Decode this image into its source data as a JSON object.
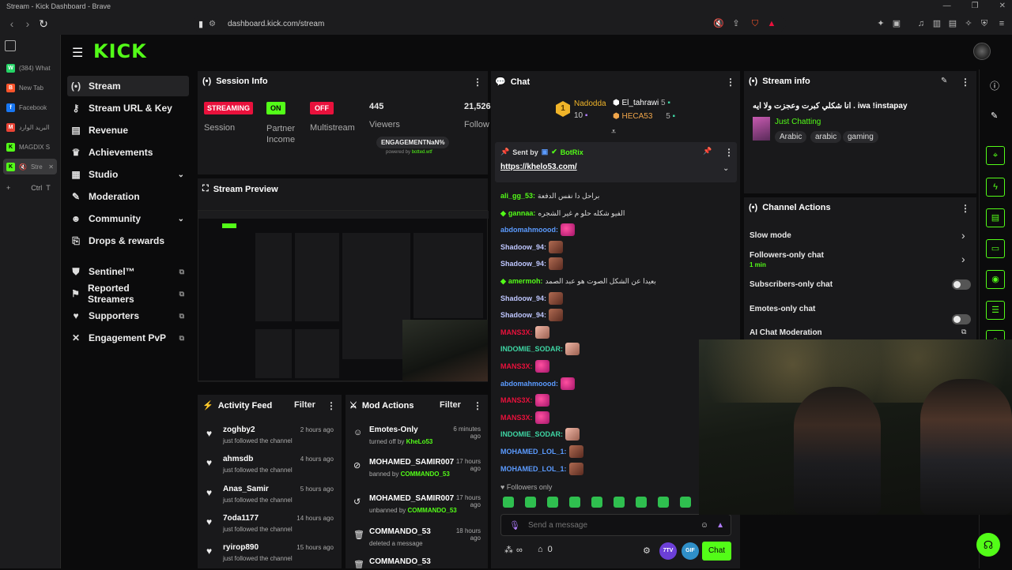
{
  "window": {
    "title": "Stream - Kick Dashboard - Brave"
  },
  "browser": {
    "url": "dashboard.kick.com/stream"
  },
  "tabs": [
    {
      "label": "(384) What",
      "color": "#25d366",
      "glyph": "W"
    },
    {
      "label": "New Tab",
      "color": "#fb542b",
      "glyph": "B"
    },
    {
      "label": "Facebook",
      "color": "#1877f2",
      "glyph": "f"
    },
    {
      "label": "البريد الوارد",
      "color": "#ea4335",
      "glyph": "M"
    },
    {
      "label": "MAGDIX S",
      "color": "#53fc18",
      "glyph": "K"
    },
    {
      "label": "Stre",
      "color": "#53fc18",
      "glyph": "K"
    }
  ],
  "new_tab_hint": {
    "ctrl": "Ctrl",
    "key": "T"
  },
  "brand": {
    "logo": "KICK",
    "accent": "#53fc18"
  },
  "nav": {
    "items": [
      {
        "label": "Stream",
        "icon": "(•)"
      },
      {
        "label": "Stream URL & Key",
        "icon": "⚷"
      },
      {
        "label": "Revenue",
        "icon": "▤"
      },
      {
        "label": "Achievements",
        "icon": "🏆"
      },
      {
        "label": "Studio",
        "icon": "▦"
      },
      {
        "label": "Moderation",
        "icon": "✎"
      },
      {
        "label": "Community",
        "icon": "👥"
      },
      {
        "label": "Drops & rewards",
        "icon": "⎘"
      },
      {
        "label": "Sentinel™",
        "icon": "⛨"
      },
      {
        "label": "Reported Streamers",
        "icon": "⚑"
      },
      {
        "label": "Supporters",
        "icon": "♥"
      },
      {
        "label": "Engagement PvP",
        "icon": "✕"
      }
    ]
  },
  "session": {
    "title": "Session Info",
    "streaming": "STREAMING",
    "on": "ON",
    "off": "OFF",
    "session_label": "Session",
    "partner_label": "Partner Income",
    "multistream_label": "Multistream",
    "viewers_value": "445",
    "viewers_label": "Viewers",
    "follow_value": "21,526",
    "follow_label": "Follow",
    "engagement": "ENGAGEMENTNaN%",
    "powered": "powered by ",
    "botted": "botted.wtf"
  },
  "preview": {
    "title": "Stream Preview"
  },
  "activity": {
    "title": "Activity Feed",
    "filter": "Filter",
    "items": [
      {
        "name": "zoghby2",
        "sub": "just followed the channel",
        "time": "2 hours ago"
      },
      {
        "name": "ahmsdb",
        "sub": "just followed the channel",
        "time": "4 hours ago"
      },
      {
        "name": "Anas_Samir",
        "sub": "just followed the channel",
        "time": "5 hours ago"
      },
      {
        "name": "7oda1177",
        "sub": "just followed the channel",
        "time": "14 hours ago"
      },
      {
        "name": "ryirop890",
        "sub": "just followed the channel",
        "time": "15 hours ago"
      }
    ]
  },
  "mod": {
    "title": "Mod Actions",
    "filter": "Filter",
    "items": [
      {
        "name": "Emotes-Only",
        "sub": "turned off by ",
        "by": "KheLo53",
        "time": "6 minutes ago",
        "icon": "☺"
      },
      {
        "name": "MOHAMED_SAMIR007",
        "sub": "banned by ",
        "by": "COMMANDO_53",
        "time": "17 hours ago",
        "icon": "⊘"
      },
      {
        "name": "MOHAMED_SAMIR007",
        "sub": "unbanned by ",
        "by": "COMMANDO_53",
        "time": "17 hours ago",
        "icon": "↺"
      },
      {
        "name": "COMMANDO_53",
        "sub": "deleted a message",
        "by": "",
        "time": "18 hours ago",
        "icon": "🗑"
      },
      {
        "name": "COMMANDO_53",
        "sub": "",
        "by": "",
        "time": "18 hours ago",
        "icon": "🗑"
      }
    ]
  },
  "chat": {
    "title": "Chat",
    "leaders": {
      "first": {
        "name": "Nadodda",
        "count": "10",
        "rank": "1"
      },
      "second": {
        "name": "El_tahrawi",
        "count": "5"
      },
      "third": {
        "name": "HECA53",
        "count": "5"
      }
    },
    "pinned": {
      "sent_by": "Sent by",
      "bot": "BotRix",
      "link": "https://khelo53.com/"
    },
    "messages": [
      {
        "user": "ali_gg_53:",
        "color": "#53fc18",
        "text": "براحل دا نفس الدفعة",
        "emote": ""
      },
      {
        "user": "gannaa:",
        "color": "#53fc18",
        "text": "الفيو شكله حلو م غير الشجره",
        "emote": ""
      },
      {
        "user": "abdomahmoood:",
        "color": "#5b9bff",
        "text": "",
        "emote": "heart"
      },
      {
        "user": "Shadoow_94:",
        "color": "#bfc7ff",
        "text": "",
        "emote": "face"
      },
      {
        "user": "Shadoow_94:",
        "color": "#bfc7ff",
        "text": "",
        "emote": "face"
      },
      {
        "user": "amermoh:",
        "color": "#53fc18",
        "text": "بعيدا عن الشكل الصوت هو عبد الصمد",
        "emote": ""
      },
      {
        "user": "Shadoow_94:",
        "color": "#bfc7ff",
        "text": "",
        "emote": "face"
      },
      {
        "user": "Shadoow_94:",
        "color": "#bfc7ff",
        "text": "",
        "emote": "face"
      },
      {
        "user": "MANS3X:",
        "color": "#e9113c",
        "text": "",
        "emote": "hand"
      },
      {
        "user": "INDOMIE_SODAR:",
        "color": "#3ed6a4",
        "text": "",
        "emote": "hand"
      },
      {
        "user": "MANS3X:",
        "color": "#e9113c",
        "text": "",
        "emote": "heart"
      },
      {
        "user": "abdomahmoood:",
        "color": "#5b9bff",
        "text": "",
        "emote": "heart"
      },
      {
        "user": "MANS3X:",
        "color": "#e9113c",
        "text": "",
        "emote": "heart"
      },
      {
        "user": "MANS3X:",
        "color": "#e9113c",
        "text": "",
        "emote": "heart"
      },
      {
        "user": "INDOMIE_SODAR:",
        "color": "#3ed6a4",
        "text": "",
        "emote": "hand"
      },
      {
        "user": "MOHAMED_LOL_1:",
        "color": "#5b9bff",
        "text": "",
        "emote": "face"
      },
      {
        "user": "MOHAMED_LOL_1:",
        "color": "#5b9bff",
        "text": "",
        "emote": "face"
      }
    ],
    "followers_only": "Followers only",
    "placeholder": "Send a message",
    "infinity": "∞",
    "count": "0",
    "send": "Chat"
  },
  "stream_info": {
    "title": "Stream info",
    "stream_title": "انا شكلي كبرت وعجزت ولا ايه . iwa !instapay",
    "category": "Just Chatting",
    "tags": [
      "Arabic",
      "arabic",
      "gaming"
    ]
  },
  "channel_actions": {
    "title": "Channel Actions",
    "slow_mode": "Slow mode",
    "followers_only": "Followers-only chat",
    "followers_min": "1 min",
    "subscribers_only": "Subscribers-only chat",
    "emotes_only": "Emotes-only chat",
    "ai_moderation": "AI Chat Moderation"
  }
}
